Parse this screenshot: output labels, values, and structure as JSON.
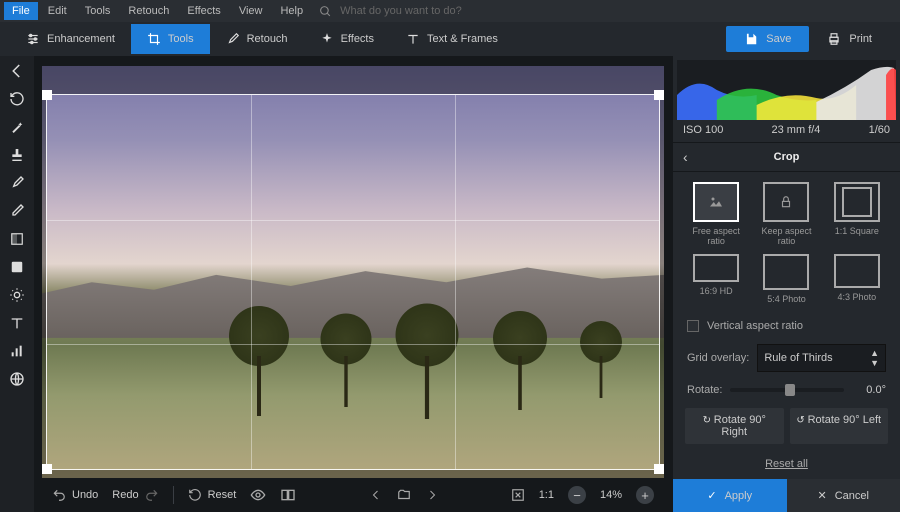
{
  "menubar": {
    "items": [
      "File",
      "Edit",
      "Tools",
      "Retouch",
      "Effects",
      "View",
      "Help"
    ],
    "active": 0,
    "search_placeholder": "What do you want to do?"
  },
  "toolbar": {
    "tabs": [
      {
        "label": "Enhancement",
        "icon": "sliders"
      },
      {
        "label": "Tools",
        "icon": "crop"
      },
      {
        "label": "Retouch",
        "icon": "brush"
      },
      {
        "label": "Effects",
        "icon": "sparkle"
      },
      {
        "label": "Text & Frames",
        "icon": "text"
      }
    ],
    "active": 1,
    "save": "Save",
    "print": "Print"
  },
  "left_tools": [
    "back-arrow",
    "rotate-ccw",
    "magic-wand",
    "stamp",
    "brush",
    "dropper",
    "square",
    "rect-fill",
    "sun",
    "text",
    "levels",
    "globe"
  ],
  "histo": {
    "iso": "ISO 100",
    "lens": "23 mm f/4",
    "shutter": "1/60"
  },
  "panel": {
    "title": "Crop",
    "ratios": [
      {
        "label": "Free aspect ratio",
        "active": true,
        "shape": "free"
      },
      {
        "label": "Keep aspect ratio",
        "shape": "keep"
      },
      {
        "label": "1:1 Square",
        "shape": "sq"
      },
      {
        "label": "16:9 HD",
        "shape": "wide"
      },
      {
        "label": "5:4 Photo",
        "shape": "r54"
      },
      {
        "label": "4:3 Photo",
        "shape": "r43"
      }
    ],
    "vertical_label": "Vertical aspect ratio",
    "overlay_label": "Grid overlay:",
    "overlay_value": "Rule of Thirds",
    "rotate_label": "Rotate:",
    "rotate_value": "0.0°",
    "rot_right": "Rotate 90° Right",
    "rot_left": "Rotate 90° Left",
    "reset": "Reset all",
    "apply": "Apply",
    "cancel": "Cancel"
  },
  "bottom": {
    "undo": "Undo",
    "redo": "Redo",
    "reset": "Reset",
    "fit": "1:1",
    "zoom": "14%"
  }
}
